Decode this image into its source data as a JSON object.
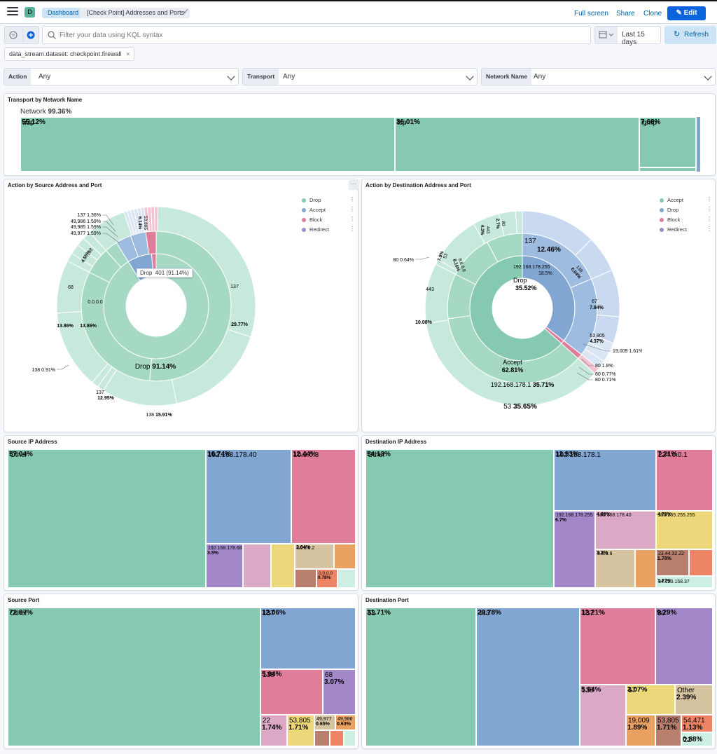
{
  "header": {
    "space_letter": "D",
    "breadcrumbs": [
      "Dashboard",
      "[Check Point] Addresses and Ports"
    ],
    "actions": [
      "Full screen",
      "Share",
      "Clone"
    ],
    "edit_label": "Edit"
  },
  "query": {
    "placeholder": "Filter your data using KQL syntax",
    "date_range": "Last 15 days",
    "refresh_label": "Refresh"
  },
  "filters": [
    "data_stream.dataset: checkpoint.firewall"
  ],
  "controls": [
    {
      "label": "Action",
      "value": "Any"
    },
    {
      "label": "Transport",
      "value": "Any"
    },
    {
      "label": "Network Name",
      "value": "Any"
    }
  ],
  "colors": {
    "green": "#85c9b1",
    "blue": "#82a6d2",
    "pink": "#e07d9b",
    "purple": "#a288c9",
    "mauve": "#dba8c6",
    "yellow": "#ecd87a",
    "tan": "#d6c3a0",
    "orange": "#e8a161",
    "brown": "#b97f6e",
    "red": "#ee8466",
    "mint": "#cdeee3",
    "accent": "#0b64dd"
  },
  "panels": {
    "transport": {
      "title": "Transport by Network Name",
      "root": {
        "name": "Network",
        "pct": "99.36%"
      },
      "segments": [
        {
          "name": "udp",
          "pct": "55.12%"
        },
        {
          "name": "tcp",
          "pct": "36.01%"
        },
        {
          "name": "igmp",
          "pct": "7.68%"
        }
      ]
    },
    "source_action": {
      "title": "Action by Source Address and Port",
      "legend": [
        "Drop",
        "Accept",
        "Block",
        "Redirect"
      ],
      "tooltip": {
        "label": "Drop",
        "value": "401 (91.14%)"
      },
      "labels": {
        "center": {
          "name": "Drop",
          "pct": "91.14%"
        },
        "ip_inner": "0.0.0.0",
        "ip_pct": "13.86%",
        "ring_pct": "13.86%",
        "p137_right": {
          "name": "137",
          "pct": "29.77%"
        },
        "p138_bottom": {
          "name": "138",
          "pct": "15.91%"
        },
        "p137_bottom": {
          "name": "137",
          "pct": "12.95%"
        },
        "p68": "68",
        "p53805": {
          "name": "53,805",
          "pct": "6.14%"
        },
        "p138_mid": {
          "name": "138",
          "pct": "4.55%"
        },
        "callouts": [
          {
            "name": "137",
            "pct": "1.36%"
          },
          {
            "name": "49,986",
            "pct": "1.59%"
          },
          {
            "name": "49,985",
            "pct": "1.59%"
          },
          {
            "name": "49,977",
            "pct": "1.59%"
          },
          {
            "name": "138",
            "pct": "0.91%"
          }
        ]
      }
    },
    "dest_action": {
      "title": "Action by Destination Address and Port",
      "legend": [
        "Accept",
        "Drop",
        "Block",
        "Redirect"
      ],
      "labels": {
        "accept": {
          "name": "Accept",
          "pct": "62.81%"
        },
        "drop": {
          "name": "Drop",
          "pct": "35.52%"
        },
        "ip_178_1": {
          "name": "192.168.178.1",
          "pct": "35.71%"
        },
        "ip_178_255": {
          "name": "192.168.178.255",
          "pct": "18.5%"
        },
        "p53": {
          "name": "53",
          "pct": "35.65%"
        },
        "p137": {
          "name": "137",
          "pct": "12.46%"
        },
        "p138": {
          "name": "138",
          "pct": "6.04%"
        },
        "p67": {
          "name": "67",
          "pct": "7.84%"
        },
        "p53805": {
          "name": "53,805",
          "pct": "4.37%"
        },
        "p443": "443",
        "pct_1008": "10.08%",
        "ip_8888": {
          "name": "8.8.8.8",
          "pct": "8.16%"
        },
        "p53_small": {
          "name": "53",
          "pct": "7.9%"
        },
        "p443_small": {
          "name": "443",
          "pct": "4.3%"
        },
        "p80_small": {
          "name": "80",
          "pct": "2.7%"
        },
        "callouts": [
          {
            "name": "80",
            "pct": "0.64%"
          },
          {
            "name": "19,009",
            "pct": "1.61%"
          },
          {
            "name": "80",
            "pct": "1.8%"
          },
          {
            "name": "80",
            "pct": "0.77%"
          },
          {
            "name": "80",
            "pct": "0.71%"
          }
        ]
      }
    },
    "source_ip": {
      "title": "Source IP Address",
      "cells": [
        {
          "name": "Other",
          "pct": "57.04%"
        },
        {
          "name": "192.168.178.40",
          "pct": "16.74%"
        },
        {
          "name": "10.0.0.3",
          "pct": "12.44%"
        },
        {
          "name": "192.168.178.68",
          "pct": "3.5%"
        },
        {
          "name": "10.0.0.2",
          "pct": "2.04%"
        },
        {
          "name": "0.0.0.0",
          "pct": "0.78%"
        }
      ]
    },
    "dest_ip": {
      "title": "Destination IP Address",
      "cells": [
        {
          "name": "Other",
          "pct": "54.13%"
        },
        {
          "name": "192.168.178.1",
          "pct": "12.93%"
        },
        {
          "name": "224.0.0.1",
          "pct": "7.21%"
        },
        {
          "name": "192.168.178.255",
          "pct": "6.7%"
        },
        {
          "name": "192.168.178.40",
          "pct": "4.89%"
        },
        {
          "name": "255.255.255.255",
          "pct": "4.73%"
        },
        {
          "name": "8.8.8.8",
          "pct": "3.2%"
        },
        {
          "name": "23.44.32.22",
          "pct": "1.78%"
        },
        {
          "name": "34.120.158.37",
          "pct": "1.27%"
        }
      ]
    },
    "source_port": {
      "title": "Source Port",
      "cells": [
        {
          "name": "Other",
          "pct": "72.87%"
        },
        {
          "name": "137",
          "pct": "12.06%"
        },
        {
          "name": "138",
          "pct": "5.94%"
        },
        {
          "name": "68",
          "pct": "3.07%"
        },
        {
          "name": "22",
          "pct": "1.74%"
        },
        {
          "name": "53,805",
          "pct": "1.71%"
        },
        {
          "name": "49,977",
          "pct": "0.65%"
        },
        {
          "name": "49,986",
          "pct": "0.63%"
        }
      ]
    },
    "dest_port": {
      "title": "Destination Port",
      "cells": [
        {
          "name": "53",
          "pct": "31.71%"
        },
        {
          "name": "443",
          "pct": "29.78%"
        },
        {
          "name": "137",
          "pct": "12.21%"
        },
        {
          "name": "80",
          "pct": "9.29%"
        },
        {
          "name": "138",
          "pct": "5.94%"
        },
        {
          "name": "67",
          "pct": "3.07%"
        },
        {
          "name": "Other",
          "pct": "2.39%"
        },
        {
          "name": "19,009",
          "pct": "1.89%"
        },
        {
          "name": "53,805",
          "pct": "1.71%"
        },
        {
          "name": "54,471",
          "pct": "1.13%"
        },
        {
          "name": "22",
          "pct": "0.88%"
        }
      ]
    }
  }
}
